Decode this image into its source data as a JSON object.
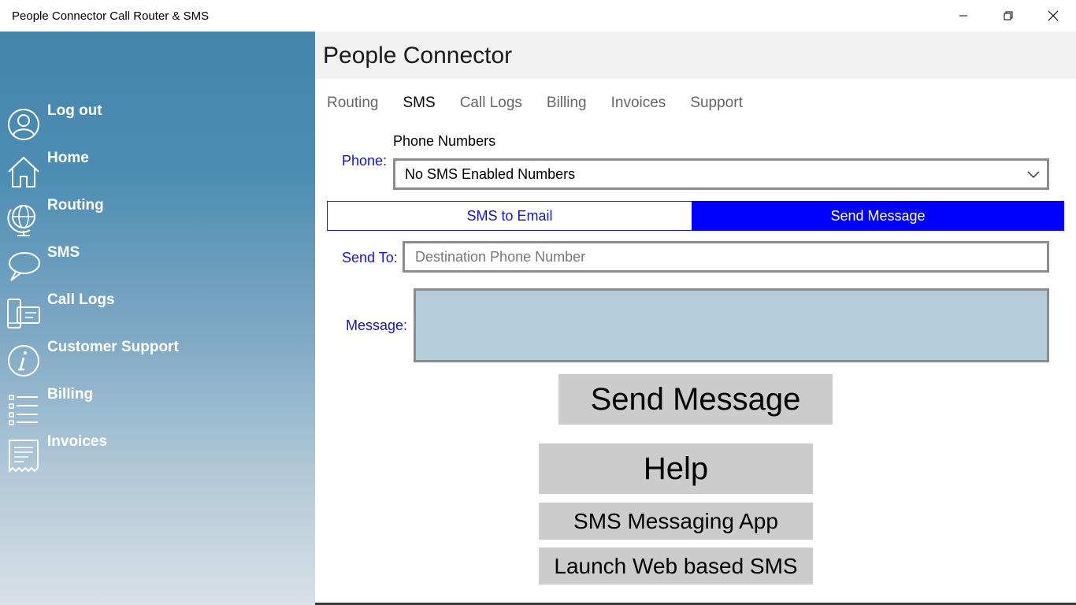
{
  "window": {
    "title": "People Connector Call Router & SMS",
    "controls": [
      "minimize-icon",
      "restore-icon",
      "close-icon"
    ]
  },
  "sidebar": {
    "items": [
      {
        "label": "Log out",
        "icon": "user-icon"
      },
      {
        "label": "Home",
        "icon": "home-icon"
      },
      {
        "label": "Routing",
        "icon": "globe-icon"
      },
      {
        "label": "SMS",
        "icon": "chat-bubble-icon"
      },
      {
        "label": "Call Logs",
        "icon": "phone-card-icon"
      },
      {
        "label": "Customer Support",
        "icon": "info-icon"
      },
      {
        "label": "Billing",
        "icon": "list-icon"
      },
      {
        "label": "Invoices",
        "icon": "receipt-icon"
      }
    ]
  },
  "header": {
    "title": "People Connector"
  },
  "tabs": [
    {
      "label": "Routing",
      "active": false
    },
    {
      "label": "SMS",
      "active": true
    },
    {
      "label": "Call Logs",
      "active": false
    },
    {
      "label": "Billing",
      "active": false
    },
    {
      "label": "Invoices",
      "active": false
    },
    {
      "label": "Support",
      "active": false
    }
  ],
  "form": {
    "phone_label": "Phone:",
    "phone_numbers_caption": "Phone Numbers",
    "phone_select_value": "No SMS Enabled Numbers",
    "mode_sms_to_email": "SMS to Email",
    "mode_send_message": "Send Message",
    "active_mode": "Send Message",
    "send_to_label": "Send To:",
    "send_to_placeholder": "Destination Phone Number",
    "send_to_value": "",
    "message_label": "Message:",
    "message_value": ""
  },
  "buttons": {
    "send": "Send Message",
    "help": "Help",
    "sms_app": "SMS Messaging App",
    "web_sms": "Launch Web based SMS"
  },
  "colors": {
    "accent_blue": "#0000ff",
    "label_blue": "#1515c7",
    "message_bg": "#b5cdda",
    "button_gray": "#cccccc",
    "sidebar_top": "#4585ab",
    "sidebar_bottom": "#d8e0e6"
  }
}
